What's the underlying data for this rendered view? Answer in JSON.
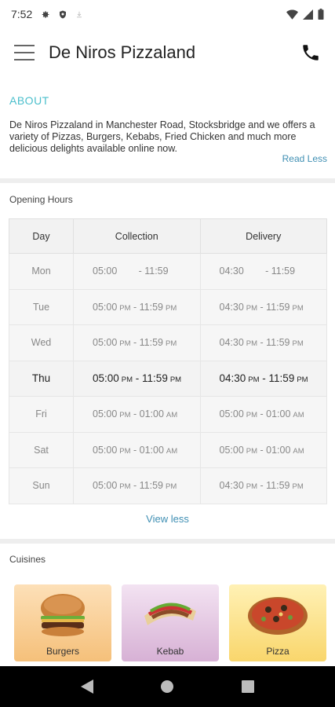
{
  "status_bar": {
    "time": "7:52"
  },
  "app_bar": {
    "title": "De Niros Pizzaland"
  },
  "about": {
    "title": "ABOUT",
    "text": "De Niros Pizzaland in Manchester Road, Stocksbridge and we offers a variety of Pizzas, Burgers, Kebabs, Fried Chicken and much more delicious delights available online now.",
    "read_less": "Read Less"
  },
  "opening_hours": {
    "label": "Opening Hours",
    "columns": [
      "Day",
      "Collection",
      "Delivery"
    ],
    "rows": [
      {
        "day": "Mon",
        "collection_start": "05:00",
        "collection_start_ampm": "",
        "collection_end": "11:59",
        "collection_end_ampm": "",
        "delivery_start": "04:30",
        "delivery_start_ampm": "",
        "delivery_end": "11:59",
        "delivery_end_ampm": ""
      },
      {
        "day": "Tue",
        "collection_start": "05:00",
        "collection_start_ampm": "PM",
        "collection_end": "11:59",
        "collection_end_ampm": "PM",
        "delivery_start": "04:30",
        "delivery_start_ampm": "PM",
        "delivery_end": "11:59",
        "delivery_end_ampm": "PM"
      },
      {
        "day": "Wed",
        "collection_start": "05:00",
        "collection_start_ampm": "PM",
        "collection_end": "11:59",
        "collection_end_ampm": "PM",
        "delivery_start": "04:30",
        "delivery_start_ampm": "PM",
        "delivery_end": "11:59",
        "delivery_end_ampm": "PM"
      },
      {
        "day": "Thu",
        "collection_start": "05:00",
        "collection_start_ampm": "PM",
        "collection_end": "11:59",
        "collection_end_ampm": "PM",
        "delivery_start": "04:30",
        "delivery_start_ampm": "PM",
        "delivery_end": "11:59",
        "delivery_end_ampm": "PM"
      },
      {
        "day": "Fri",
        "collection_start": "05:00",
        "collection_start_ampm": "PM",
        "collection_end": "01:00",
        "collection_end_ampm": "AM",
        "delivery_start": "05:00",
        "delivery_start_ampm": "PM",
        "delivery_end": "01:00",
        "delivery_end_ampm": "AM"
      },
      {
        "day": "Sat",
        "collection_start": "05:00",
        "collection_start_ampm": "PM",
        "collection_end": "01:00",
        "collection_end_ampm": "AM",
        "delivery_start": "05:00",
        "delivery_start_ampm": "PM",
        "delivery_end": "01:00",
        "delivery_end_ampm": "AM"
      },
      {
        "day": "Sun",
        "collection_start": "05:00",
        "collection_start_ampm": "PM",
        "collection_end": "11:59",
        "collection_end_ampm": "PM",
        "delivery_start": "04:30",
        "delivery_start_ampm": "PM",
        "delivery_end": "11:59",
        "delivery_end_ampm": "PM"
      }
    ],
    "active_day": "Thu",
    "view_less": "View less"
  },
  "cuisines": {
    "label": "Cuisines",
    "items": [
      {
        "name": "Burgers"
      },
      {
        "name": "Kebab"
      },
      {
        "name": "Pizza"
      }
    ]
  },
  "colors": {
    "accent": "#4bbfcc",
    "link": "#3f8fb3"
  },
  "icons": [
    "settings-icon",
    "shield-icon",
    "download-icon",
    "wifi-icon",
    "signal-icon",
    "battery-icon",
    "menu-icon",
    "phone-icon",
    "back-icon",
    "home-icon",
    "recents-icon"
  ]
}
